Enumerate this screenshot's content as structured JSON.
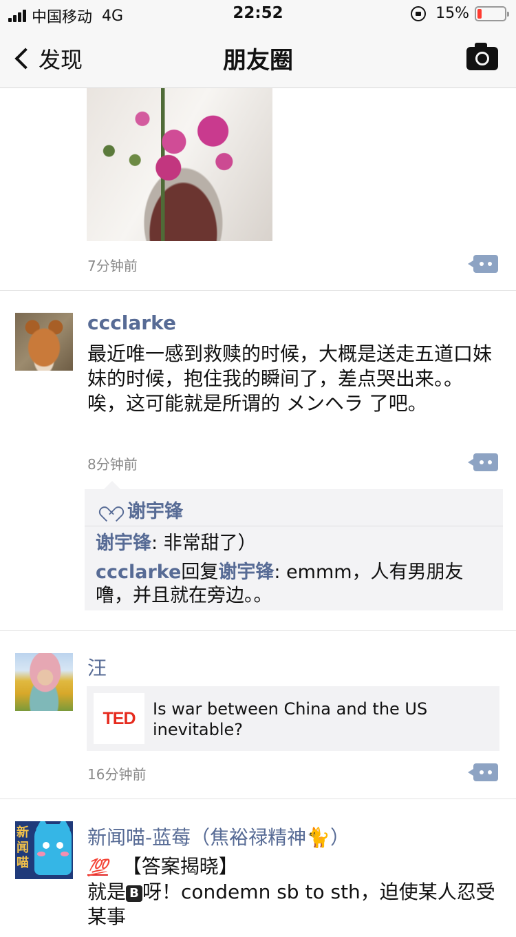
{
  "status_bar": {
    "carrier": "中国移动",
    "network": "4G",
    "time": "22:52",
    "battery_text": "15%",
    "battery_level": 0.15
  },
  "nav": {
    "back_label": "发现",
    "title": "朋友圈"
  },
  "posts": [
    {
      "timestamp": "7分钟前"
    },
    {
      "author": "ccclarke",
      "text": "最近唯一感到救赎的时候，大概是送走五道口妹妹的时候，抱住我的瞬间了，差点哭出来。。唉，这可能就是所谓的 メンヘラ 了吧。",
      "timestamp": "8分钟前",
      "likes": "谢宇锋",
      "comments": [
        {
          "from": "谢宇锋",
          "reply_word": "",
          "to": "",
          "text": ": 非常甜了）"
        },
        {
          "from": "ccclarke",
          "reply_word": "回复",
          "to": "谢宇锋",
          "text": ": emmm，人有男朋友噜，并且就在旁边。。"
        }
      ]
    },
    {
      "author": "汪",
      "link_logo": "TED",
      "link_title": "Is war between China and the US inevitable?",
      "timestamp": "16分钟前"
    },
    {
      "author": "新闻喵-蓝莓（焦裕禄精神🐈）",
      "avatar_text": "新闻喵",
      "badge": "💯",
      "line1": "【答案揭晓】",
      "line2_prefix": "就是",
      "line2_key": "B",
      "line2_suffix": "呀！condemn sb to sth，迫使某人忍受某事"
    }
  ]
}
